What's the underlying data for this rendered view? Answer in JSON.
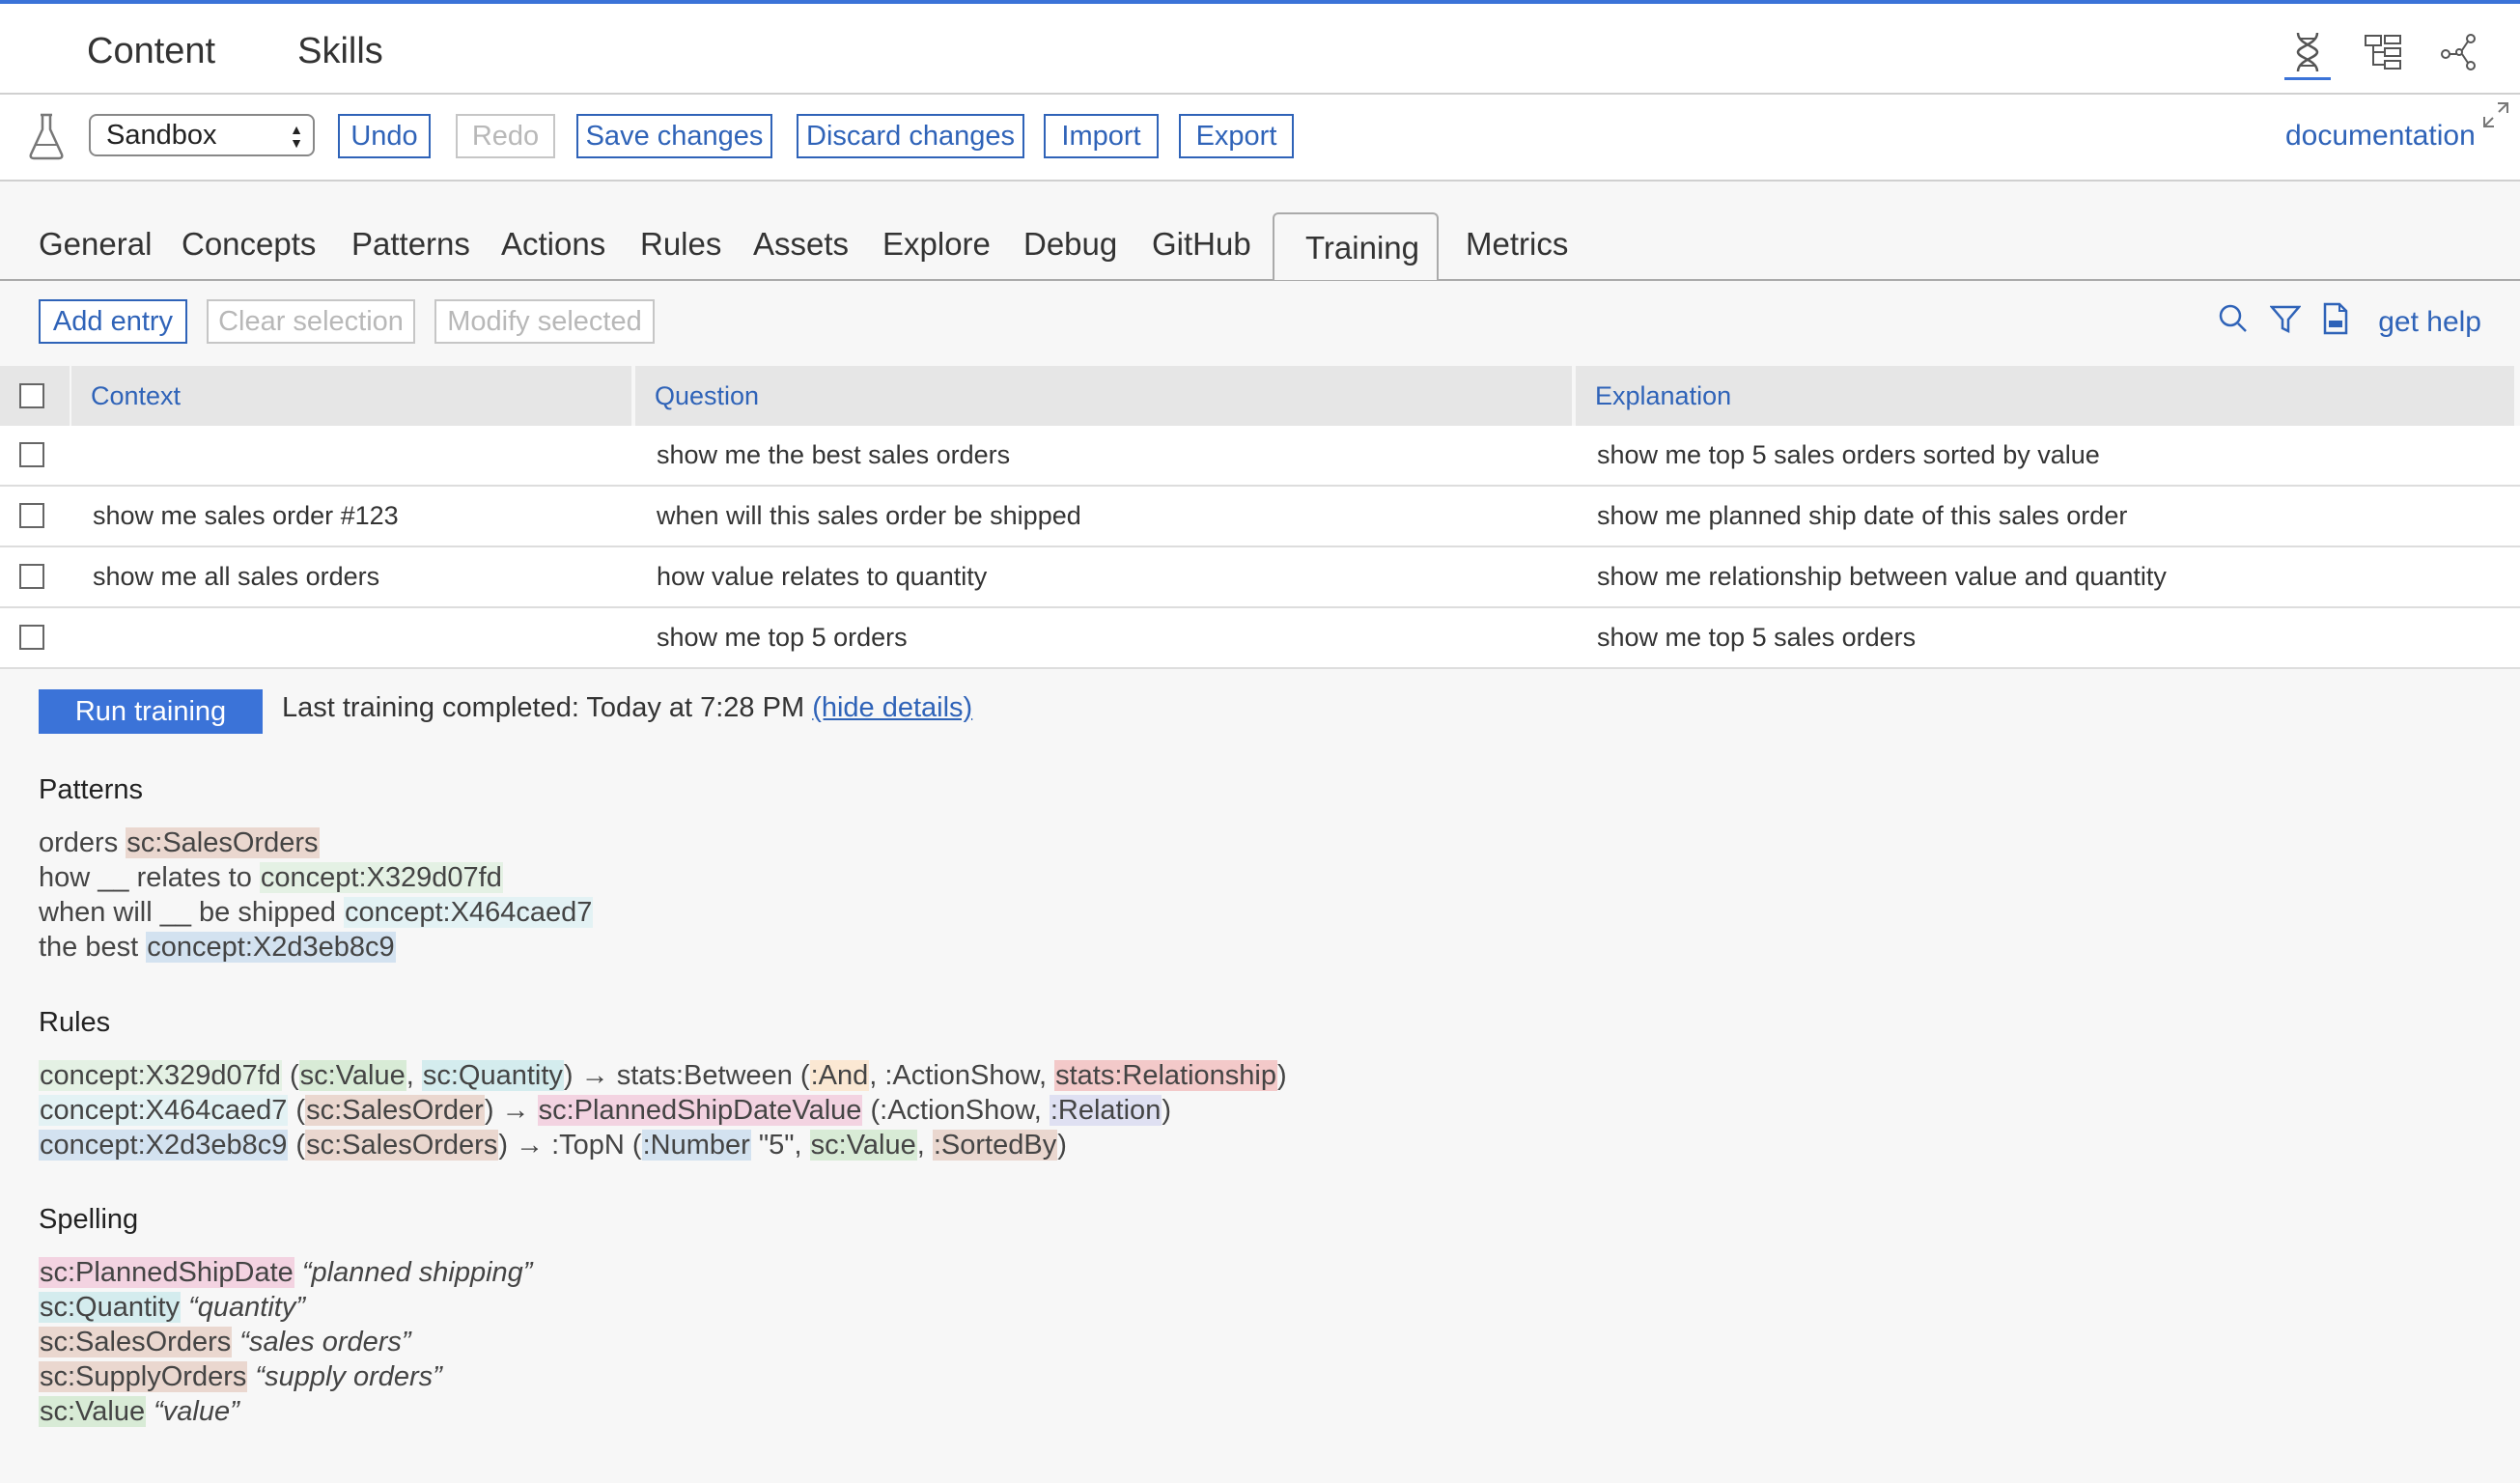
{
  "app": {
    "topnav": [
      "Content",
      "Skills"
    ],
    "topicons": [
      "dna-icon",
      "tree-icon",
      "network-icon"
    ]
  },
  "toolbar": {
    "environment": "Sandbox",
    "undo": "Undo",
    "redo": "Redo",
    "save": "Save changes",
    "discard": "Discard changes",
    "import": "Import",
    "export": "Export",
    "documentation": "documentation"
  },
  "tabs": [
    "General",
    "Concepts",
    "Patterns",
    "Actions",
    "Rules",
    "Assets",
    "Explore",
    "Debug",
    "GitHub",
    "Training",
    "Metrics"
  ],
  "active_tab": "Training",
  "entrybar": {
    "add": "Add entry",
    "clear": "Clear selection",
    "modify": "Modify selected",
    "help": "get help"
  },
  "table": {
    "headers": [
      "Context",
      "Question",
      "Explanation"
    ],
    "rows": [
      {
        "context": "",
        "question": "show me the best sales orders",
        "explanation": "show me top 5 sales orders sorted by value"
      },
      {
        "context": "show me sales order #123",
        "question": "when will this sales order be shipped",
        "explanation": "show me planned ship date of this sales order"
      },
      {
        "context": "show me all sales orders",
        "question": "how value relates to quantity",
        "explanation": "show me relationship between value and quantity"
      },
      {
        "context": "",
        "question": "show me top 5 orders",
        "explanation": "show me top 5 sales orders"
      }
    ]
  },
  "training": {
    "run": "Run training",
    "last": "Last training completed: Today at 7:28 PM",
    "hide": "(hide details)"
  },
  "patterns": {
    "title": "Patterns",
    "lines": [
      [
        "orders ",
        "sc:SalesOrders"
      ],
      [
        "how __ relates to ",
        "concept:X329d07fd"
      ],
      [
        "when will __ be shipped ",
        "concept:X464caed7"
      ],
      [
        "the best ",
        "concept:X2d3eb8c9"
      ]
    ]
  },
  "rules": {
    "title": "Rules",
    "r1": [
      "concept:X329d07fd",
      " (",
      "sc:Value",
      ", ",
      "sc:Quantity",
      ") → stats:Between (",
      ":And",
      ", :ActionShow, ",
      "stats:Relationship",
      ")"
    ],
    "r2": [
      "concept:X464caed7",
      " (",
      "sc:SalesOrder",
      ") → ",
      "sc:PlannedShipDateValue",
      " (:ActionShow, ",
      ":Relation",
      ")"
    ],
    "r3": [
      "concept:X2d3eb8c9",
      " (",
      "sc:SalesOrders",
      ") → :TopN (",
      ":Number",
      " \"5\", ",
      "sc:Value",
      ", ",
      ":SortedBy",
      ")"
    ]
  },
  "spelling": {
    "title": "Spelling",
    "lines": [
      [
        "sc:PlannedShipDate",
        " “planned shipping”"
      ],
      [
        "sc:Quantity",
        " “quantity”"
      ],
      [
        "sc:SalesOrders",
        " “sales orders”"
      ],
      [
        "sc:SupplyOrders",
        " “supply orders”"
      ],
      [
        "sc:Value",
        " “value”"
      ]
    ]
  }
}
